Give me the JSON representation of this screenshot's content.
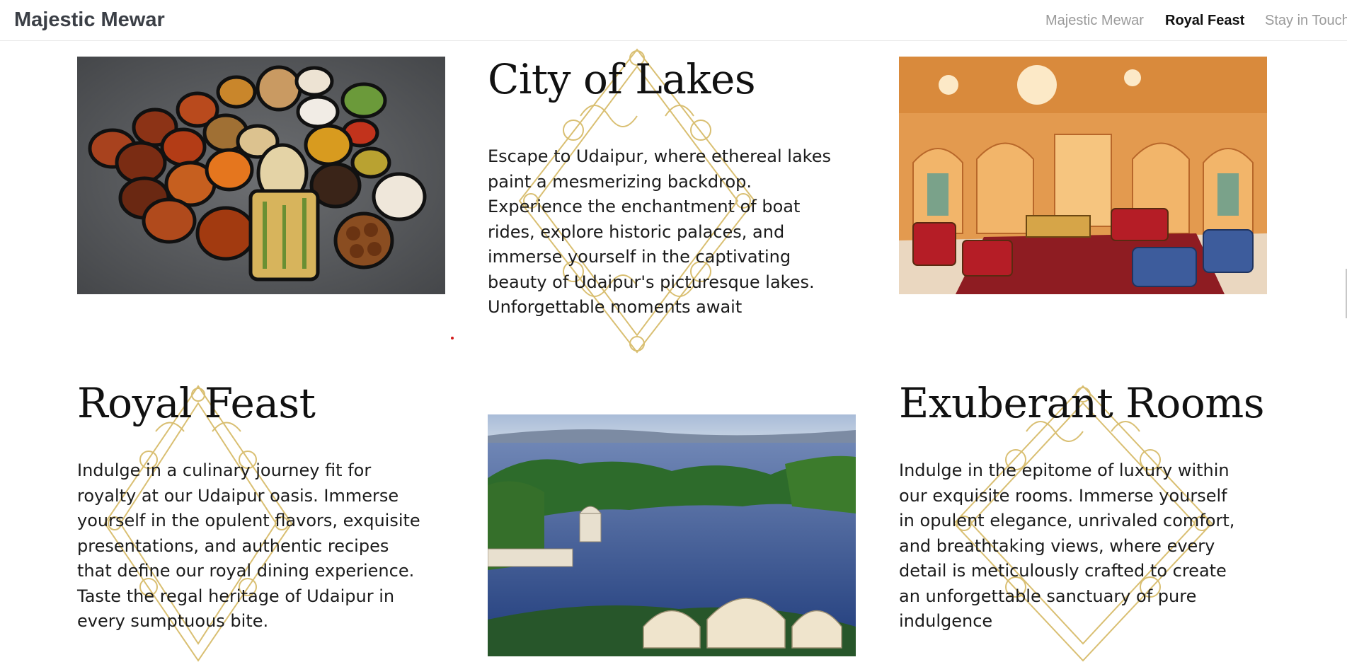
{
  "navbar": {
    "brand": "Majestic Mewar",
    "links": [
      {
        "label": "Majestic Mewar",
        "active": false
      },
      {
        "label": "Royal Feast",
        "active": true
      },
      {
        "label": "Stay in Touch",
        "active": false
      }
    ]
  },
  "sections": {
    "city": {
      "title": "City of Lakes",
      "text": "Escape to Udaipur, where ethereal lakes paint a mesmerizing backdrop. Experience the enchantment of boat rides, explore historic palaces, and immerse yourself in the captivating beauty of Udaipur's picturesque lakes. Unforgettable moments await"
    },
    "feast": {
      "title": "Royal Feast",
      "text": "Indulge in a culinary journey fit for royalty at our Udaipur oasis. Immerse yourself in the opulent flavors, exquisite presentations, and authentic recipes that define our royal dining experience. Taste the regal heritage of Udaipur in every sumptuous bite."
    },
    "rooms": {
      "title": "Exuberant Rooms",
      "text": "Indulge in the epitome of luxury within our exquisite rooms. Immerse yourself in opulent elegance, unrivaled comfort, and breathtaking views, where every detail is meticulously crafted to create an unforgettable sanctuary of pure indulgence"
    }
  },
  "colors": {
    "ornament_gold": "#d9bf72",
    "active_link": "#111111",
    "inactive_link": "#9a9a9a"
  }
}
